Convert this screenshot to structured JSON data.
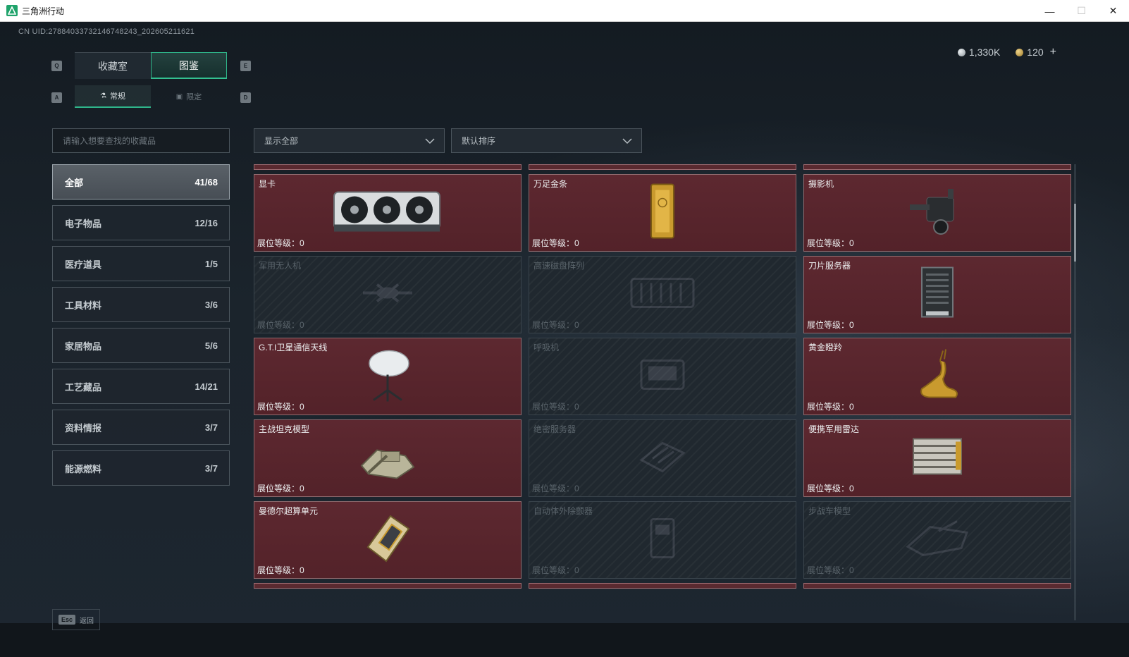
{
  "window": {
    "title": "三角洲行动",
    "controls": {
      "minimize": "—",
      "maximize": "☐",
      "close": "✕"
    }
  },
  "uid_text": "CN UID:27884033732146748243_202605211621",
  "currency": {
    "silver": "1,330K",
    "gold": "120",
    "add_label": "+"
  },
  "key_hints": {
    "tab_left": "Q",
    "tab_right": "E",
    "sub_left": "A",
    "sub_right": "D"
  },
  "tabs": [
    {
      "label": "收藏室",
      "active": false
    },
    {
      "label": "图鉴",
      "active": true
    }
  ],
  "subtabs": [
    {
      "label": "常规",
      "icon": "flask-icon",
      "active": true
    },
    {
      "label": "限定",
      "icon": "image-icon",
      "active": false
    }
  ],
  "search": {
    "placeholder": "请输入想要查找的收藏品"
  },
  "filters": {
    "display": "显示全部",
    "sort": "默认排序"
  },
  "categories": [
    {
      "label": "全部",
      "count": "41/68",
      "active": true
    },
    {
      "label": "电子物品",
      "count": "12/16",
      "active": false
    },
    {
      "label": "医疗道具",
      "count": "1/5",
      "active": false
    },
    {
      "label": "工具材料",
      "count": "3/6",
      "active": false
    },
    {
      "label": "家居物品",
      "count": "5/6",
      "active": false
    },
    {
      "label": "工艺藏品",
      "count": "14/21",
      "active": false
    },
    {
      "label": "资料情报",
      "count": "3/7",
      "active": false
    },
    {
      "label": "能源燃料",
      "count": "3/7",
      "active": false
    }
  ],
  "level_label": "展位等级：",
  "items": [
    {
      "name": "显卡",
      "level": "0",
      "unlocked": true,
      "icon": "graphics-card-icon"
    },
    {
      "name": "万足金条",
      "level": "0",
      "unlocked": true,
      "icon": "gold-bar-icon"
    },
    {
      "name": "摄影机",
      "level": "0",
      "unlocked": true,
      "icon": "camera-icon"
    },
    {
      "name": "军用无人机",
      "level": "0",
      "unlocked": false,
      "icon": "drone-icon"
    },
    {
      "name": "高速磁盘阵列",
      "level": "0",
      "unlocked": false,
      "icon": "disk-array-icon"
    },
    {
      "name": "刀片服务器",
      "level": "0",
      "unlocked": true,
      "icon": "server-icon"
    },
    {
      "name": "G.T.I卫星通信天线",
      "level": "0",
      "unlocked": true,
      "icon": "satellite-dish-icon"
    },
    {
      "name": "呼吸机",
      "level": "0",
      "unlocked": false,
      "icon": "ventilator-icon"
    },
    {
      "name": "黄金瞪羚",
      "level": "0",
      "unlocked": true,
      "icon": "golden-gazelle-icon"
    },
    {
      "name": "主战坦克模型",
      "level": "0",
      "unlocked": true,
      "icon": "tank-icon"
    },
    {
      "name": "绝密服务器",
      "level": "0",
      "unlocked": false,
      "icon": "secret-server-icon"
    },
    {
      "name": "便携军用雷达",
      "level": "0",
      "unlocked": true,
      "icon": "radar-icon"
    },
    {
      "name": "曼德尔超算单元",
      "level": "0",
      "unlocked": true,
      "icon": "cpu-chip-icon"
    },
    {
      "name": "自动体外除颤器",
      "level": "0",
      "unlocked": false,
      "icon": "defibrillator-icon"
    },
    {
      "name": "步战车模型",
      "level": "0",
      "unlocked": false,
      "icon": "ifv-icon"
    }
  ],
  "bottom": {
    "esc_key": "Esc",
    "back_label": "返回"
  }
}
